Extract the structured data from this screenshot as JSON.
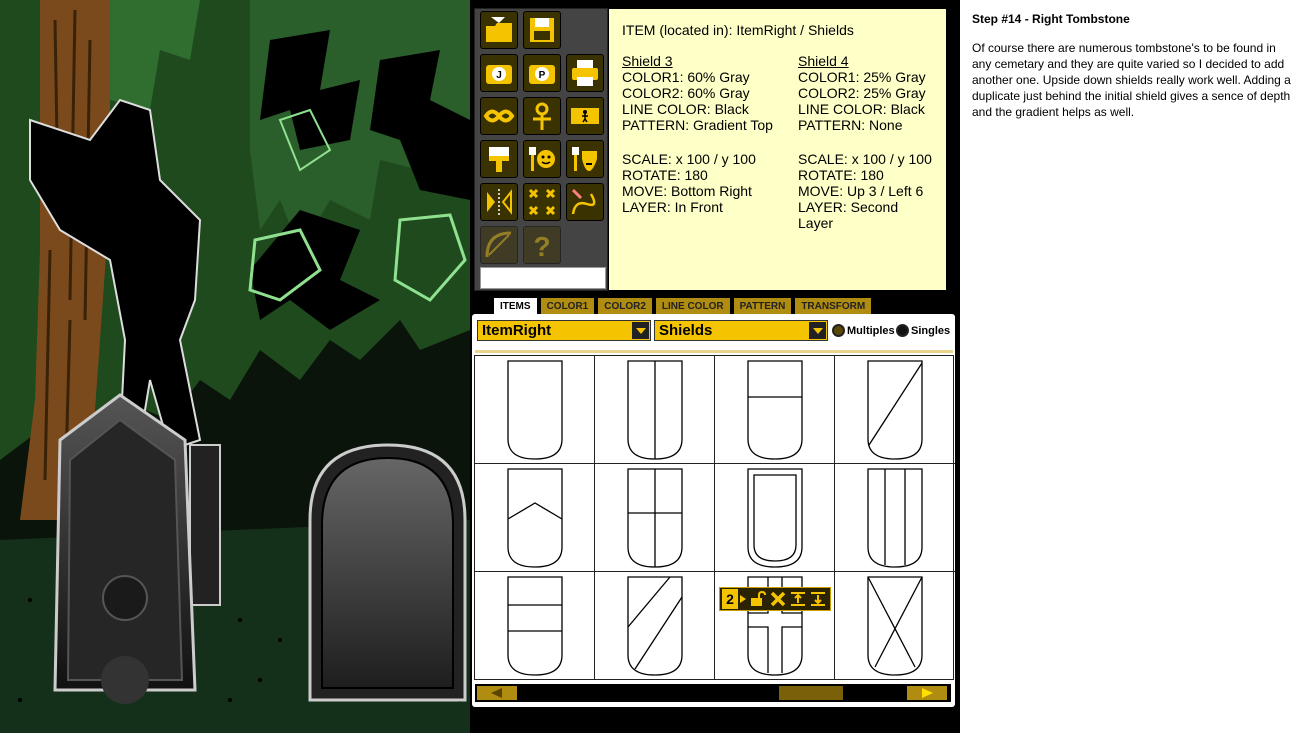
{
  "info": {
    "title": "ITEM (located in): ItemRight / Shields",
    "shield3": {
      "heading": "Shield 3",
      "color1": "COLOR1: 60% Gray",
      "color2": "COLOR2: 60% Gray",
      "line_color": "LINE COLOR: Black",
      "pattern": "PATTERN: Gradient Top",
      "scale": "SCALE: x 100 / y 100",
      "rotate": "ROTATE: 180",
      "move": "MOVE: Bottom Right",
      "layer": "LAYER: In Front"
    },
    "shield4": {
      "heading": "Shield 4",
      "color1": "COLOR1: 25% Gray",
      "color2": "COLOR2: 25% Gray",
      "line_color": "LINE COLOR: Black",
      "pattern": "PATTERN: None",
      "scale": "SCALE: x 100 / y 100",
      "rotate": "ROTATE: 180",
      "move": "MOVE: Up 3 / Left 6",
      "layer": "LAYER: Second",
      "layer_cont": "Layer"
    }
  },
  "tabs": [
    "ITEMS",
    "COLOR1",
    "COLOR2",
    "LINE COLOR",
    "PATTERN",
    "TRANSFORM"
  ],
  "dropdowns": {
    "category": "ItemRight",
    "subcategory": "Shields"
  },
  "radio": {
    "multiples": "Multiples",
    "singles": "Singles"
  },
  "layer_number": "2",
  "toolbar_icons": [
    "open-icon",
    "save-icon",
    "jpeg-icon",
    "png-icon",
    "print-icon",
    "mask-icon",
    "ankh-icon",
    "figure-icon",
    "paint-brush-icon",
    "face-brush-icon",
    "beard-brush-icon",
    "split-icon",
    "shuffle-icon",
    "draw-icon",
    "bow-icon",
    "help-icon"
  ],
  "colors": {
    "accent": "#f5c400",
    "info_bg": "#ffffc8",
    "tab_bg": "#b08c10"
  },
  "step": {
    "heading": "Step #14 - Right Tombstone",
    "body": "Of course there are numerous tombstone's to be found in any cemetary and they are quite varied so I decided to add another one. Upside down shields really work well. Adding a duplicate just behind the initial shield gives a sence of depth and the gradient helps as well."
  }
}
